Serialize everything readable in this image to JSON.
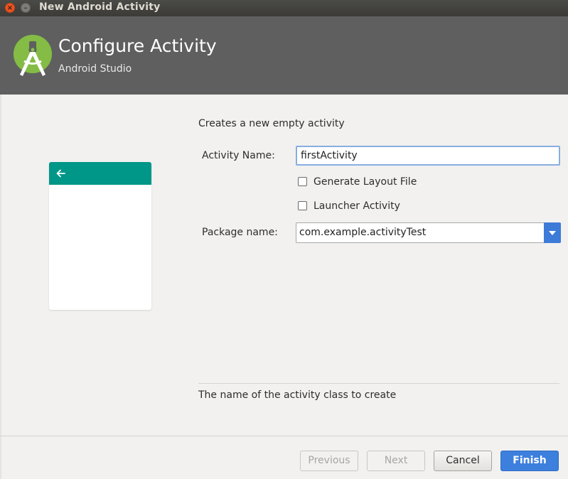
{
  "window": {
    "title": "New Android Activity",
    "close_glyph": "×",
    "minimize_glyph": "–"
  },
  "header": {
    "title": "Configure Activity",
    "subtitle": "Android Studio",
    "logo_icon": "android-studio-logo-icon",
    "background_color": "#5f5f5f"
  },
  "preview": {
    "toolbar_color": "#009688",
    "back_icon": "arrow-back-icon"
  },
  "form": {
    "description": "Creates a new empty activity",
    "activity_name_label": "Activity Name:",
    "activity_name_value": "firstActivity",
    "generate_layout_label": "Generate Layout File",
    "generate_layout_checked": false,
    "launcher_activity_label": "Launcher Activity",
    "launcher_activity_checked": false,
    "package_name_label": "Package name:",
    "package_name_value": "com.example.activityTest"
  },
  "hint": "The name of the activity class to create",
  "buttons": {
    "previous": "Previous",
    "next": "Next",
    "cancel": "Cancel",
    "finish": "Finish"
  },
  "colors": {
    "accent": "#3d7fdd",
    "input_focus_border": "#87aee1",
    "close_button": "#e95420"
  }
}
